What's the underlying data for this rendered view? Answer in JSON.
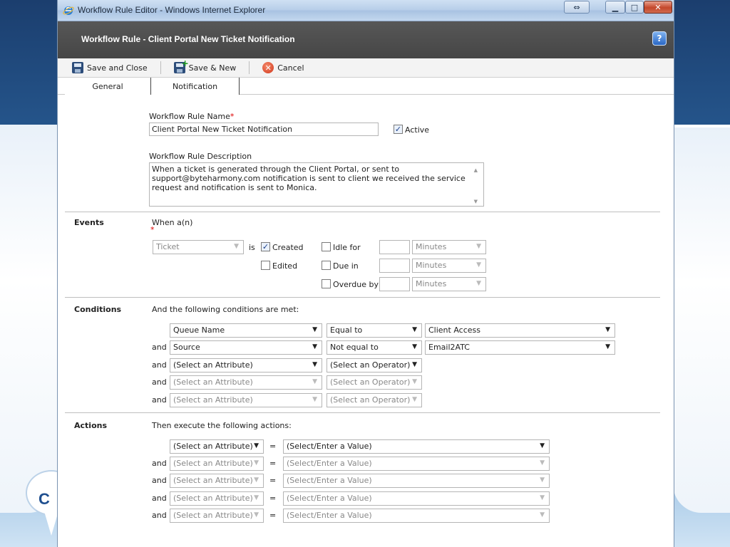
{
  "window": {
    "title": "Workflow Rule Editor - Windows Internet Explorer"
  },
  "header": {
    "title": "Workflow Rule - Client Portal New Ticket Notification"
  },
  "toolbar": {
    "save_close": "Save and Close",
    "save_new": "Save & New",
    "cancel": "Cancel"
  },
  "tabs": {
    "general": "General",
    "notification": "Notification"
  },
  "general": {
    "name_label": "Workflow Rule Name",
    "name_value": "Client Portal New Ticket Notification",
    "active_label": "Active",
    "active_checked": true,
    "desc_label": "Workflow Rule Description",
    "desc_value": "When a ticket is generated through the Client Portal, or sent to support@byteharmony.com notification is sent to client we received the service request and notification is sent to Monica."
  },
  "events": {
    "section": "Events",
    "when_label": "When a(n)",
    "entity": "Ticket",
    "is_label": "is",
    "created": "Created",
    "edited": "Edited",
    "idle_for": "Idle for",
    "due_in": "Due in",
    "overdue_by": "Overdue by",
    "unit": "Minutes"
  },
  "conditions": {
    "section": "Conditions",
    "intro": "And the following conditions are met:",
    "and": "and",
    "rows": [
      {
        "attr": "Queue Name",
        "op": "Equal to",
        "value": "Client Access"
      },
      {
        "attr": "Source",
        "op": "Not equal to",
        "value": "Email2ATC"
      },
      {
        "attr": "(Select an Attribute)",
        "op": "(Select an Operator)"
      },
      {
        "attr": "(Select an Attribute)",
        "op": "(Select an Operator)"
      },
      {
        "attr": "(Select an Attribute)",
        "op": "(Select an Operator)"
      }
    ]
  },
  "actions": {
    "section": "Actions",
    "intro": "Then execute the following actions:",
    "and": "and",
    "eq": "=",
    "rows": [
      {
        "attr": "(Select an Attribute)",
        "value": "(Select/Enter a Value)"
      },
      {
        "attr": "(Select an Attribute)",
        "value": "(Select/Enter a Value)"
      },
      {
        "attr": "(Select an Attribute)",
        "value": "(Select/Enter a Value)"
      },
      {
        "attr": "(Select an Attribute)",
        "value": "(Select/Enter a Value)"
      },
      {
        "attr": "(Select an Attribute)",
        "value": "(Select/Enter a Value)"
      }
    ]
  },
  "logo": {
    "text": "C"
  }
}
